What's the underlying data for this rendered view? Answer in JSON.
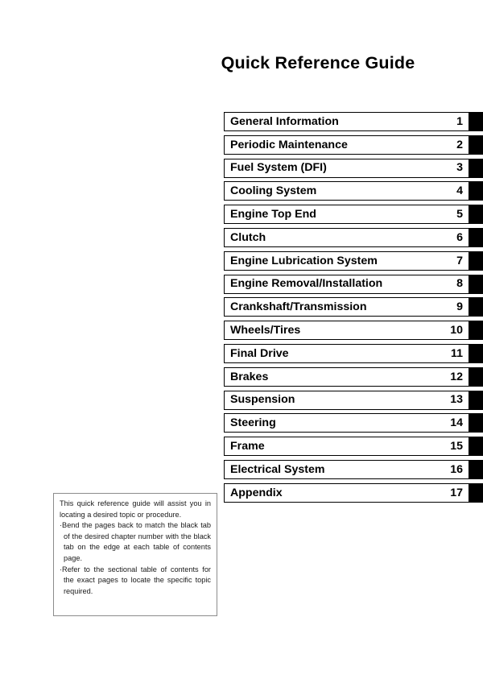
{
  "page": {
    "title": "Quick Reference Guide",
    "background_color": "#ffffff",
    "text_color": "#000000",
    "tab_color": "#000000",
    "note_border_color": "#8c8c8c"
  },
  "chapters": [
    {
      "label": "General Information",
      "number": "1"
    },
    {
      "label": "Periodic Maintenance",
      "number": "2"
    },
    {
      "label": "Fuel System (DFI)",
      "number": "3"
    },
    {
      "label": "Cooling System",
      "number": "4"
    },
    {
      "label": "Engine Top End",
      "number": "5"
    },
    {
      "label": "Clutch",
      "number": "6"
    },
    {
      "label": "Engine Lubrication System",
      "number": "7"
    },
    {
      "label": "Engine Removal/Installation",
      "number": "8"
    },
    {
      "label": "Crankshaft/Transmission",
      "number": "9"
    },
    {
      "label": "Wheels/Tires",
      "number": "10"
    },
    {
      "label": "Final Drive",
      "number": "11"
    },
    {
      "label": "Brakes",
      "number": "12"
    },
    {
      "label": "Suspension",
      "number": "13"
    },
    {
      "label": "Steering",
      "number": "14"
    },
    {
      "label": "Frame",
      "number": "15"
    },
    {
      "label": "Electrical System",
      "number": "16"
    },
    {
      "label": "Appendix",
      "number": "17"
    }
  ],
  "note": {
    "intro": "This quick reference guide will assist you in locating a desired topic or procedure.",
    "bullets": [
      "·Bend the pages back to match the black tab of the desired chapter number with the black tab on the edge at each table of contents page.",
      "·Refer to the sectional table of contents for the exact pages to locate the specific topic required."
    ]
  }
}
